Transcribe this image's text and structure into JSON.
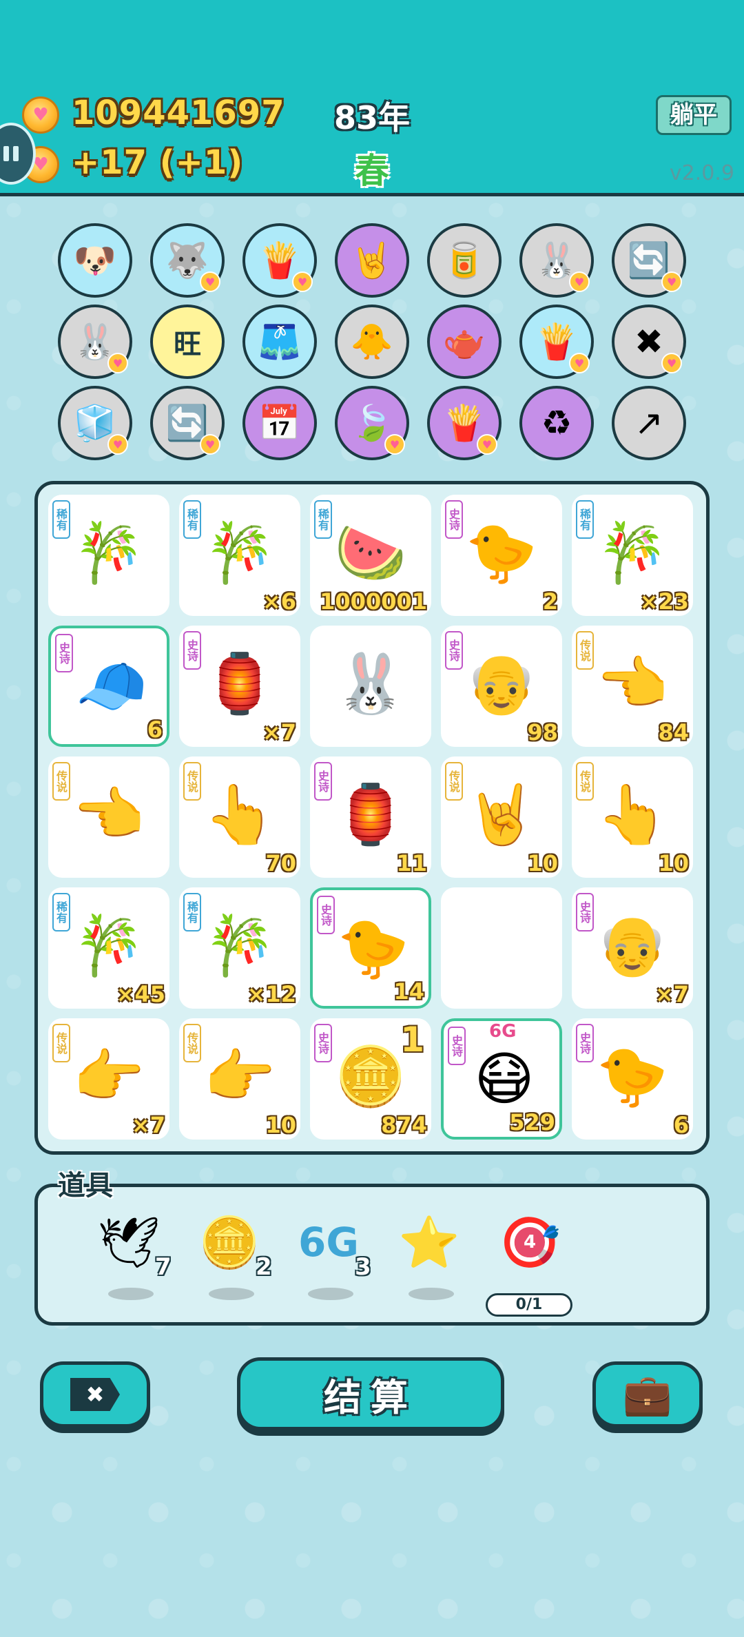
{
  "header": {
    "coins": "109441697",
    "income": "+17 (+1)",
    "year": "83年",
    "season": "春",
    "lie_flat_label": "躺平",
    "version": "v2.0.9"
  },
  "tools": [
    {
      "icon": "🐶",
      "color": "c-blue",
      "badge": false
    },
    {
      "icon": "🐺",
      "color": "c-blue",
      "badge": true
    },
    {
      "icon": "🍟",
      "color": "c-blue",
      "badge": true
    },
    {
      "icon": "🤘",
      "color": "c-purple",
      "badge": false
    },
    {
      "icon": "🥫",
      "color": "c-grey",
      "badge": false
    },
    {
      "icon": "🐰",
      "color": "c-grey",
      "badge": true
    },
    {
      "icon": "🔄",
      "color": "c-grey",
      "badge": true
    },
    {
      "icon": "🐰",
      "color": "c-grey",
      "badge": true
    },
    {
      "icon": "旺",
      "color": "c-yellow",
      "badge": false
    },
    {
      "icon": "🩳",
      "color": "c-blue",
      "badge": false
    },
    {
      "icon": "🐥",
      "color": "c-grey",
      "badge": false
    },
    {
      "icon": "🫖",
      "color": "c-purple",
      "badge": false
    },
    {
      "icon": "🍟",
      "color": "c-blue",
      "badge": true
    },
    {
      "icon": "✖",
      "color": "c-grey",
      "badge": true
    },
    {
      "icon": "🧊",
      "color": "c-grey",
      "badge": true
    },
    {
      "icon": "🔄",
      "color": "c-grey",
      "badge": true
    },
    {
      "icon": "📅",
      "color": "c-purple",
      "badge": false
    },
    {
      "icon": "🍃",
      "color": "c-purple",
      "badge": true
    },
    {
      "icon": "🍟",
      "color": "c-purple",
      "badge": true
    },
    {
      "icon": "♻",
      "color": "c-purple",
      "badge": false
    },
    {
      "icon": "↗",
      "color": "c-grey",
      "badge": false
    }
  ],
  "board": [
    {
      "rarity": "稀有",
      "kind": "rare",
      "art": "🎋",
      "count": ""
    },
    {
      "rarity": "稀有",
      "kind": "rare",
      "art": "🎋",
      "count": "×6"
    },
    {
      "rarity": "稀有",
      "kind": "rare",
      "art": "🍉",
      "count": "1000001"
    },
    {
      "rarity": "史诗",
      "kind": "epic",
      "art": "🐤",
      "count": "2"
    },
    {
      "rarity": "稀有",
      "kind": "rare",
      "art": "🎋",
      "count": "×23"
    },
    {
      "rarity": "史诗",
      "kind": "epic",
      "art": "🧢",
      "count": "6",
      "highlight": true
    },
    {
      "rarity": "史诗",
      "kind": "epic",
      "art": "🏮",
      "count": "×7"
    },
    {
      "rarity": "",
      "kind": "none",
      "art": "🐰",
      "count": ""
    },
    {
      "rarity": "史诗",
      "kind": "epic",
      "art": "👴",
      "count": "98"
    },
    {
      "rarity": "传说",
      "kind": "legend",
      "art": "👈",
      "count": "84"
    },
    {
      "rarity": "传说",
      "kind": "legend",
      "art": "👈",
      "count": ""
    },
    {
      "rarity": "传说",
      "kind": "legend",
      "art": "👆",
      "count": "70"
    },
    {
      "rarity": "史诗",
      "kind": "epic",
      "art": "🏮",
      "count": "11"
    },
    {
      "rarity": "传说",
      "kind": "legend",
      "art": "🤘",
      "count": "10"
    },
    {
      "rarity": "传说",
      "kind": "legend",
      "art": "👆",
      "count": "10"
    },
    {
      "rarity": "稀有",
      "kind": "rare",
      "art": "🎋",
      "count": "×45"
    },
    {
      "rarity": "稀有",
      "kind": "rare",
      "art": "🎋",
      "count": "×12"
    },
    {
      "rarity": "史诗",
      "kind": "epic",
      "art": "🐤",
      "count": "14",
      "highlight": true
    },
    {
      "rarity": "",
      "kind": "none",
      "art": "",
      "count": ""
    },
    {
      "rarity": "史诗",
      "kind": "epic",
      "art": "👴",
      "count": "×7"
    },
    {
      "rarity": "传说",
      "kind": "legend",
      "art": "👉",
      "count": "×7"
    },
    {
      "rarity": "传说",
      "kind": "legend",
      "art": "👉",
      "count": "10"
    },
    {
      "rarity": "史诗",
      "kind": "epic",
      "art": "🪙",
      "count": "874",
      "float_text": "1"
    },
    {
      "rarity": "史诗",
      "kind": "epic",
      "art": "😷",
      "count": "529",
      "highlight": true,
      "tag": "6G"
    },
    {
      "rarity": "史诗",
      "kind": "epic",
      "art": "🐤",
      "count": "6"
    }
  ],
  "props": {
    "title": "道具",
    "items": [
      {
        "name": "dove",
        "icon": "🕊",
        "qty": "7"
      },
      {
        "name": "coin",
        "icon": "🪙",
        "qty": "2"
      },
      {
        "name": "6g",
        "icon": "6G",
        "qty": "3"
      },
      {
        "name": "star",
        "icon": "⭐",
        "qty": ""
      },
      {
        "name": "target",
        "icon": "🎯",
        "qty": "",
        "progress": "0/1",
        "num": "4"
      }
    ]
  },
  "buttons": {
    "close_label": "✖",
    "settle_label": "结算",
    "bag_label": "💼"
  }
}
